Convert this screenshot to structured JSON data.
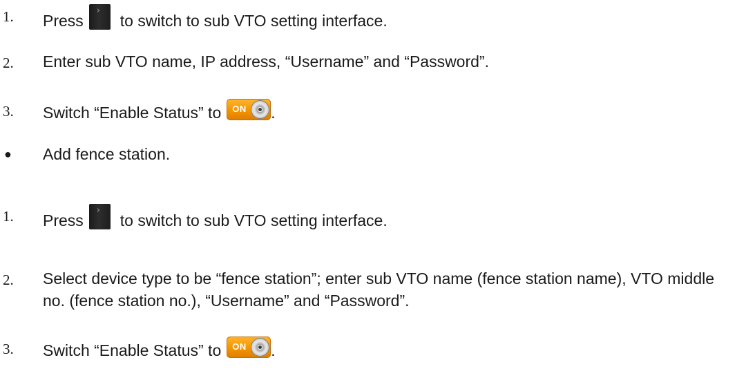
{
  "steps": [
    {
      "marker": "1.",
      "text_before": "Press",
      "text_after": "to switch to sub VTO setting interface.",
      "icon": "arrow-icon"
    },
    {
      "marker": "2.",
      "text": "Enter sub VTO name, IP address, “Username” and “Password”."
    },
    {
      "marker": "3.",
      "text_before": "Switch “Enable Status” to",
      "text_after": ".",
      "icon": "on-toggle-icon",
      "toggle_label": "ON"
    },
    {
      "marker": "●",
      "text": "Add fence station."
    },
    {
      "marker": "1.",
      "text_before": "Press",
      "text_after": "to switch to sub VTO setting interface.",
      "icon": "arrow-icon"
    },
    {
      "marker": "2.",
      "text": "Select device type to be “fence station”; enter sub VTO name (fence station name), VTO middle no. (fence station no.), “Username” and “Password”."
    },
    {
      "marker": "3.",
      "text_before": "Switch “Enable Status” to",
      "text_after": ".",
      "icon": "on-toggle-icon",
      "toggle_label": "ON"
    }
  ],
  "colors": {
    "text": "#1a1a1a",
    "toggle_orange": "#f39400",
    "arrow_button_dark": "#1e1e1e"
  }
}
